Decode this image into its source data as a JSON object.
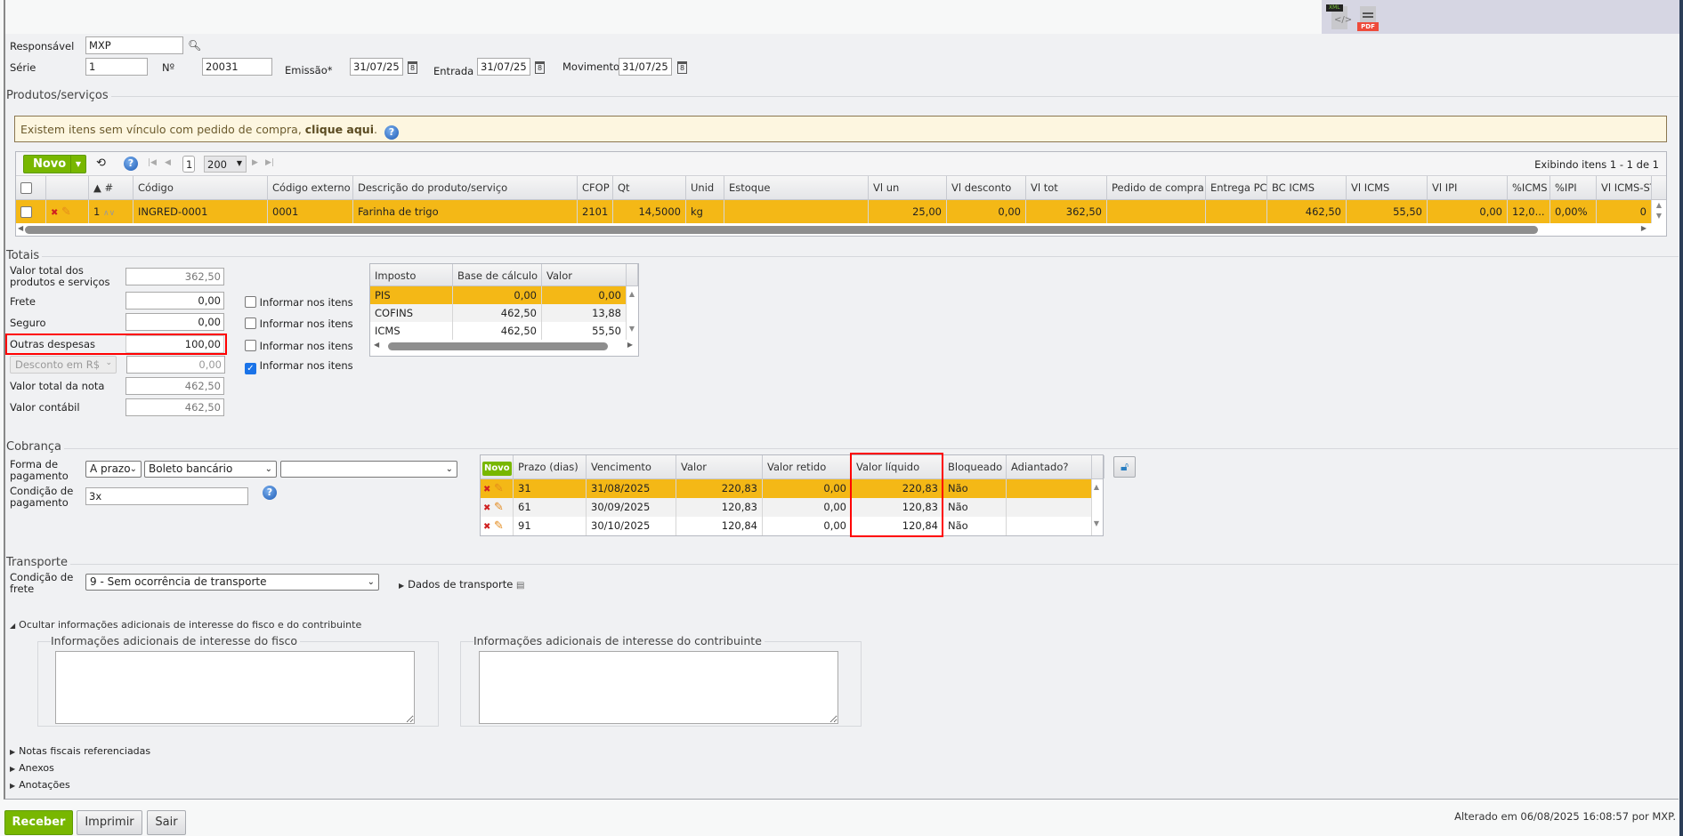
{
  "header": {
    "responsavel_label": "Responsável",
    "responsavel_value": "MXP",
    "serie_label": "Série",
    "serie_value": "1",
    "numero_label": "Nº",
    "numero_value": "20031",
    "emissao_label": "Emissão*",
    "emissao_value": "31/07/25",
    "entrada_label": "Entrada",
    "entrada_value": "31/07/25",
    "movimento_label": "Movimento",
    "movimento_value": "31/07/25",
    "calendar_glyph": "8",
    "xml_label": "XML",
    "pdf_label": "PDF"
  },
  "produtos": {
    "legend": "Produtos/serviços",
    "notice_text": "Existem itens sem vínculo com pedido de compra, ",
    "notice_link": "clique aqui",
    "notice_end": ".",
    "novo_label": "Novo",
    "page": "1",
    "page_size": "200",
    "showing": "Exibindo itens 1 - 1 de 1",
    "columns": [
      "",
      "",
      "▲ #",
      "Código",
      "Código externo",
      "Descrição do produto/serviço",
      "CFOP",
      "Qt",
      "Unid",
      "Estoque",
      "Vl un",
      "Vl desconto",
      "Vl tot",
      "Pedido de compra",
      "Entrega PC",
      "BC ICMS",
      "Vl ICMS",
      "Vl IPI",
      "%ICMS",
      "%IPI",
      "Vl ICMS-ST"
    ],
    "rows": [
      {
        "num": "1",
        "codigo": "INGRED-0001",
        "codigo_externo": "0001",
        "descricao": "Farinha de trigo",
        "cfop": "2101",
        "qt": "14,5000",
        "unid": "kg",
        "estoque": "",
        "vl_un": "25,00",
        "vl_desconto": "0,00",
        "vl_tot": "362,50",
        "pedido": "",
        "entrega": "",
        "bc_icms": "462,50",
        "vl_icms": "55,50",
        "vl_ipi": "0,00",
        "p_icms": "12,0...",
        "p_ipi": "0,00%",
        "vl_icms_st": "0"
      }
    ]
  },
  "totais": {
    "legend": "Totais",
    "valor_produtos_label": "Valor total dos produtos e serviços",
    "valor_produtos": "362,50",
    "frete_label": "Frete",
    "frete": "0,00",
    "seguro_label": "Seguro",
    "seguro": "0,00",
    "outras_label": "Outras despesas",
    "outras": "100,00",
    "desconto_select": "Desconto em R$",
    "desconto": "0,00",
    "valor_nota_label": "Valor total da nota",
    "valor_nota": "462,50",
    "valor_contabil_label": "Valor contábil",
    "valor_contabil": "462,50",
    "informar_label": "Informar nos itens",
    "informar_checked": [
      false,
      false,
      false,
      true
    ],
    "impostos_columns": [
      "Imposto",
      "Base de cálculo",
      "Valor"
    ],
    "impostos": [
      {
        "imposto": "PIS",
        "base": "0,00",
        "valor": "0,00"
      },
      {
        "imposto": "COFINS",
        "base": "462,50",
        "valor": "13,88"
      },
      {
        "imposto": "ICMS",
        "base": "462,50",
        "valor": "55,50"
      }
    ]
  },
  "cobranca": {
    "legend": "Cobrança",
    "forma_label": "Forma de pagamento",
    "forma_tipo": "A prazo",
    "forma_meio": "Boleto bancário",
    "forma_extra": "",
    "condicao_label": "Condição de pagamento",
    "condicao": "3x",
    "novo_label": "Novo",
    "columns": [
      "Prazo (dias)",
      "Vencimento",
      "Valor",
      "Valor retido",
      "Valor líquido",
      "Bloqueado",
      "Adiantado?"
    ],
    "parcelas": [
      {
        "prazo": "31",
        "vencimento": "31/08/2025",
        "valor": "220,83",
        "retido": "0,00",
        "liquido": "220,83",
        "bloqueado": "Não",
        "adiantado": ""
      },
      {
        "prazo": "61",
        "vencimento": "30/09/2025",
        "valor": "120,83",
        "retido": "0,00",
        "liquido": "120,83",
        "bloqueado": "Não",
        "adiantado": ""
      },
      {
        "prazo": "91",
        "vencimento": "30/10/2025",
        "valor": "120,84",
        "retido": "0,00",
        "liquido": "120,84",
        "bloqueado": "Não",
        "adiantado": ""
      }
    ]
  },
  "transporte": {
    "legend": "Transporte",
    "condicao_label": "Condição de frete",
    "condicao": "9 - Sem ocorrência de transporte",
    "dados_link": "Dados de transporte"
  },
  "adicionais": {
    "toggle": "Ocultar informações adicionais de interesse do fisco e do contribuinte",
    "fisco_legend": "Informações adicionais de interesse do fisco",
    "contribuinte_legend": "Informações adicionais de interesse do contribuinte",
    "fisco_value": "",
    "contribuinte_value": ""
  },
  "sections": {
    "notas": "Notas fiscais referenciadas",
    "anexos": "Anexos",
    "anotacoes": "Anotações"
  },
  "footer": {
    "receber": "Receber",
    "imprimir": "Imprimir",
    "sair": "Sair",
    "alterado": "Alterado em 06/08/2025 16:08:57 por MXP."
  },
  "colors": {
    "accent_green": "#78b700",
    "selected_row": "#f4b816",
    "highlight": "#ff0000"
  }
}
